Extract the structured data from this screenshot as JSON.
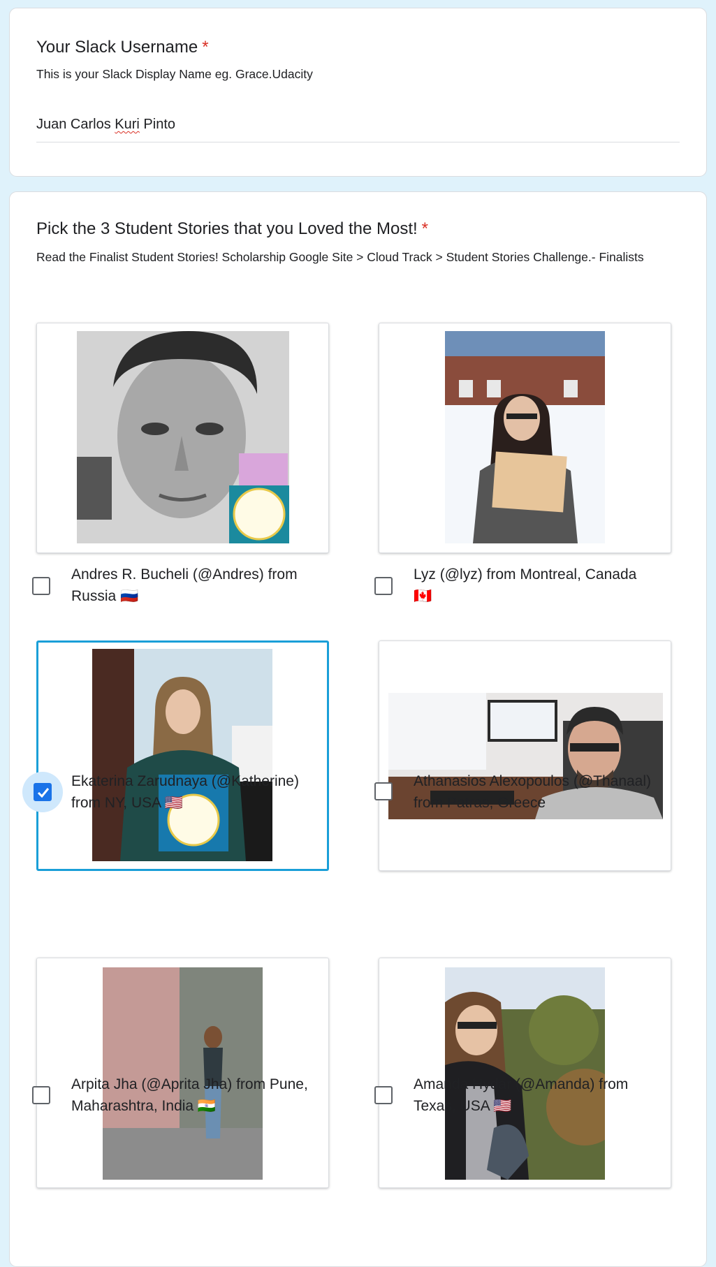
{
  "q1": {
    "title": "Your Slack Username",
    "required_mark": "*",
    "description": "This is your Slack Display Name eg. Grace.Udacity",
    "answer_pre": "Juan Carlos ",
    "answer_misspelled": "Kuri",
    "answer_post": " Pinto"
  },
  "q2": {
    "title": "Pick the 3 Student Stories that you Loved the Most!",
    "required_mark": "*",
    "description": "Read the Finalist Student Stories! Scholarship Google Site > Cloud Track > Student Stories Challenge.- Finalists",
    "options": [
      {
        "line1": "Andres R. Bucheli (@Andres) from",
        "line2": "Russia 🇷🇺",
        "checked": false
      },
      {
        "line1": "Lyz (@lyz) from Montreal, Canada",
        "line2": "🇨🇦",
        "checked": false
      },
      {
        "line1": "Ekaterina Zarudnaya (@Katherine)",
        "line2": "from NY, USA 🇺🇸",
        "checked": true
      },
      {
        "line1": "Athanasios Alexopoulos (@Thanaal)",
        "line2": "from Patras, Greece",
        "checked": false
      },
      {
        "line1": "Arpita Jha (@Aprita Jha) from Pune,",
        "line2": "Maharashtra, India 🇮🇳",
        "checked": false
      },
      {
        "line1": "Amanda Hydar (@Amanda) from",
        "line2": "Texas, USA 🇺🇸",
        "checked": false
      }
    ]
  },
  "colors": {
    "page_background": "#dff2fb",
    "required": "#d93025",
    "checkbox_checked": "#1a73e8",
    "selected_border": "#1a9fd8"
  }
}
